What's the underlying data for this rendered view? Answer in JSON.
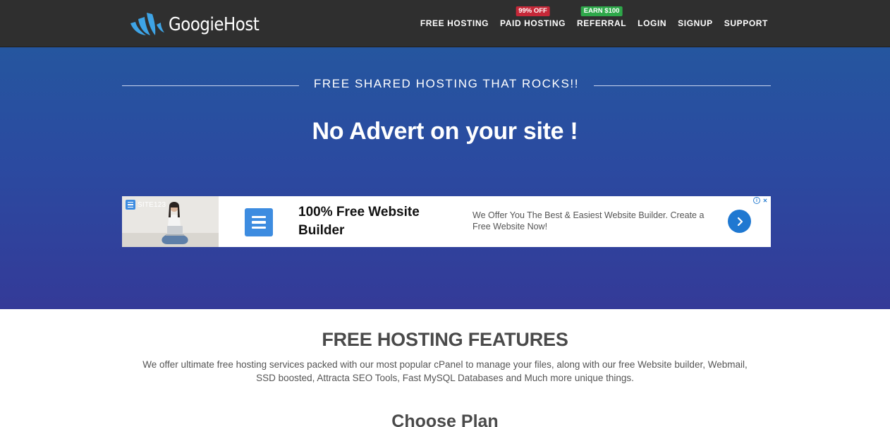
{
  "brand": {
    "name": "GoogieHost"
  },
  "nav": [
    {
      "label": "FREE HOSTING",
      "badge": null
    },
    {
      "label": "PAID HOSTING",
      "badge": "99% OFF",
      "badge_color": "#c62838"
    },
    {
      "label": "REFERRAL",
      "badge": "EARN $100",
      "badge_color": "#2ea84a"
    },
    {
      "label": "LOGIN",
      "badge": null
    },
    {
      "label": "SIGNUP",
      "badge": null
    },
    {
      "label": "SUPPORT",
      "badge": null
    }
  ],
  "hero": {
    "tagline": "FREE SHARED HOSTING THAT ROCKS!!",
    "headline": "No Advert on your site !"
  },
  "ad": {
    "brand": "SITE123",
    "title": "100% Free Website Builder",
    "description": "We Offer You The Best & Easiest Website Builder. Create a Free Website Now!",
    "cta_icon": "chevron-right-icon"
  },
  "features": {
    "title": "FREE HOSTING FEATURES",
    "description": "We offer ultimate free hosting services packed with our most popular cPanel to manage your files, along with our free Website builder, Webmail, SSD boosted, Attracta SEO Tools, Fast MySQL Databases and Much more unique things."
  },
  "plans": {
    "title": "Choose Plan"
  },
  "colors": {
    "navbar": "#2f2f2f",
    "hero_top": "#25569f",
    "hero_bottom": "#343a98",
    "logo_accent": "#3ea4e6",
    "badge_red": "#c62838",
    "badge_green": "#2ea84a"
  }
}
